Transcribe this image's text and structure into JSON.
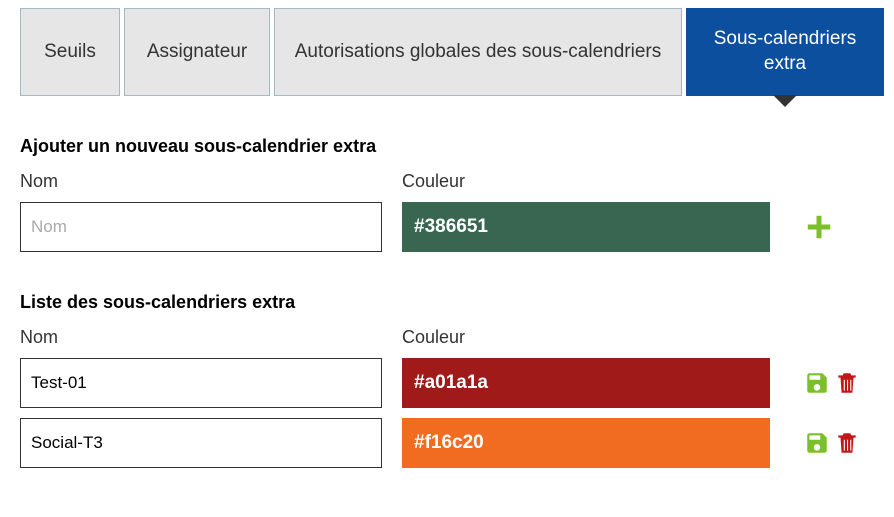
{
  "tabs": {
    "seuils": "Seuils",
    "assignateur": "Assignateur",
    "auth": "Autorisations globales des sous-calendriers",
    "extra": "Sous-calendriers extra"
  },
  "add_section": {
    "title": "Ajouter un nouveau sous-calendrier extra",
    "nom_label": "Nom",
    "couleur_label": "Couleur",
    "nom_placeholder": "Nom",
    "couleur_value": "#386651"
  },
  "list_section": {
    "title": "Liste des sous-calendriers extra",
    "nom_label": "Nom",
    "couleur_label": "Couleur",
    "items": [
      {
        "nom": "Test-01",
        "couleur": "#a01a1a"
      },
      {
        "nom": "Social-T3",
        "couleur": "#f16c20"
      }
    ]
  }
}
